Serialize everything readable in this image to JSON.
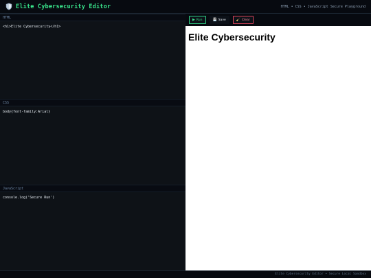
{
  "header": {
    "title": "Elite Cybersecurity Editor",
    "subtitle": "HTML • CSS • JavaScript Secure Playground",
    "icon": "shield-icon"
  },
  "editors": {
    "html": {
      "label": "HTML",
      "code": "<h1>Elite Cybersecurity</h1>"
    },
    "css": {
      "label": "CSS",
      "code": "body{font-family:Arial}"
    },
    "js": {
      "label": "JavaScript",
      "code": "console.log('Secure Run')"
    }
  },
  "toolbar": {
    "run_label": "Run",
    "run_icon": "▶",
    "save_label": "Save",
    "save_icon": "💾",
    "clear_label": "Clear",
    "clear_icon": "🧹"
  },
  "preview": {
    "heading": "Elite Cybersecurity"
  },
  "footer": {
    "text": "Elite Cybersecurity Editor • Secure Local Sandbox"
  },
  "colors": {
    "accent": "#39e58c",
    "background": "#0b0f14",
    "danger": "#e0445c"
  }
}
